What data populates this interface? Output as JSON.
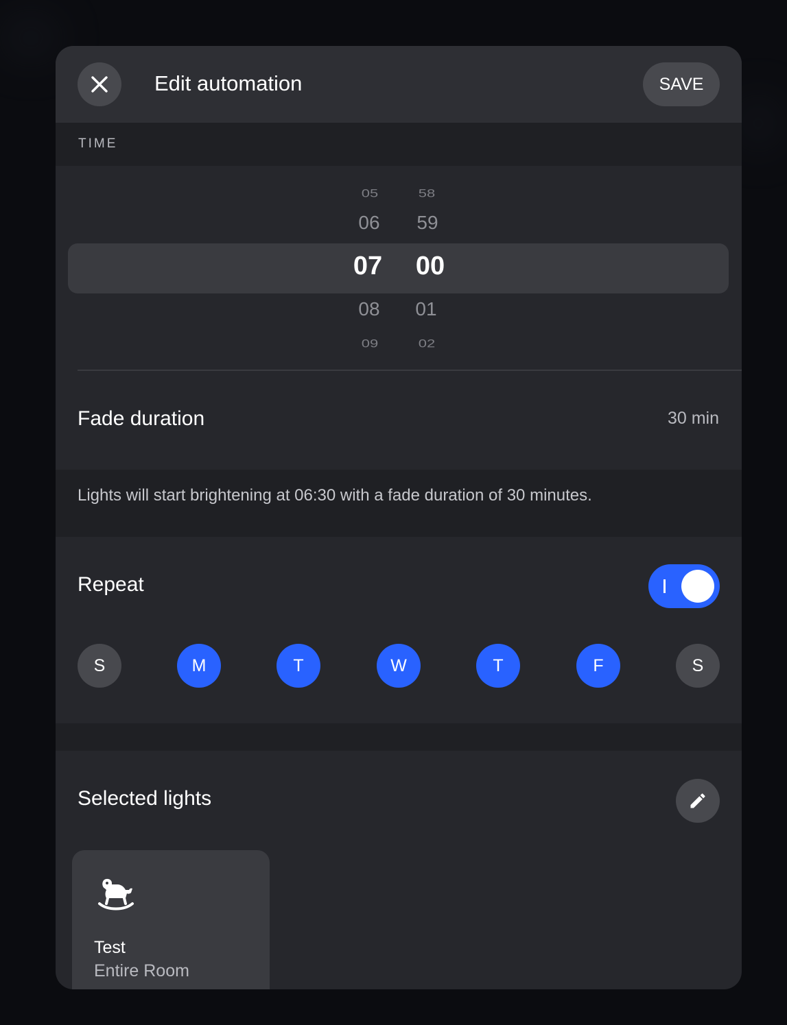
{
  "header": {
    "title": "Edit automation",
    "save_label": "SAVE"
  },
  "time_section": {
    "label": "TIME"
  },
  "picker": {
    "hours": {
      "above2": "05",
      "above1": "06",
      "selected": "07",
      "below1": "08",
      "below2": "09"
    },
    "minutes": {
      "above2": "58",
      "above1": "59",
      "selected": "00",
      "below1": "01",
      "below2": "02"
    }
  },
  "fade": {
    "label": "Fade duration",
    "value": "30 min",
    "info": "Lights will start brightening at 06:30 with a fade duration of 30 minutes."
  },
  "repeat": {
    "label": "Repeat",
    "toggle_on": true,
    "days": [
      {
        "letter": "S",
        "active": false
      },
      {
        "letter": "M",
        "active": true
      },
      {
        "letter": "T",
        "active": true
      },
      {
        "letter": "W",
        "active": true
      },
      {
        "letter": "T",
        "active": true
      },
      {
        "letter": "F",
        "active": true
      },
      {
        "letter": "S",
        "active": false
      }
    ]
  },
  "selected_lights": {
    "label": "Selected lights",
    "items": [
      {
        "name": "Test",
        "subtitle": "Entire Room",
        "icon": "rocking-horse-icon"
      }
    ]
  },
  "colors": {
    "accent": "#2962ff",
    "modal_bg": "#26272c",
    "header_bg": "#2e2f34",
    "button_bg": "#48494e"
  }
}
